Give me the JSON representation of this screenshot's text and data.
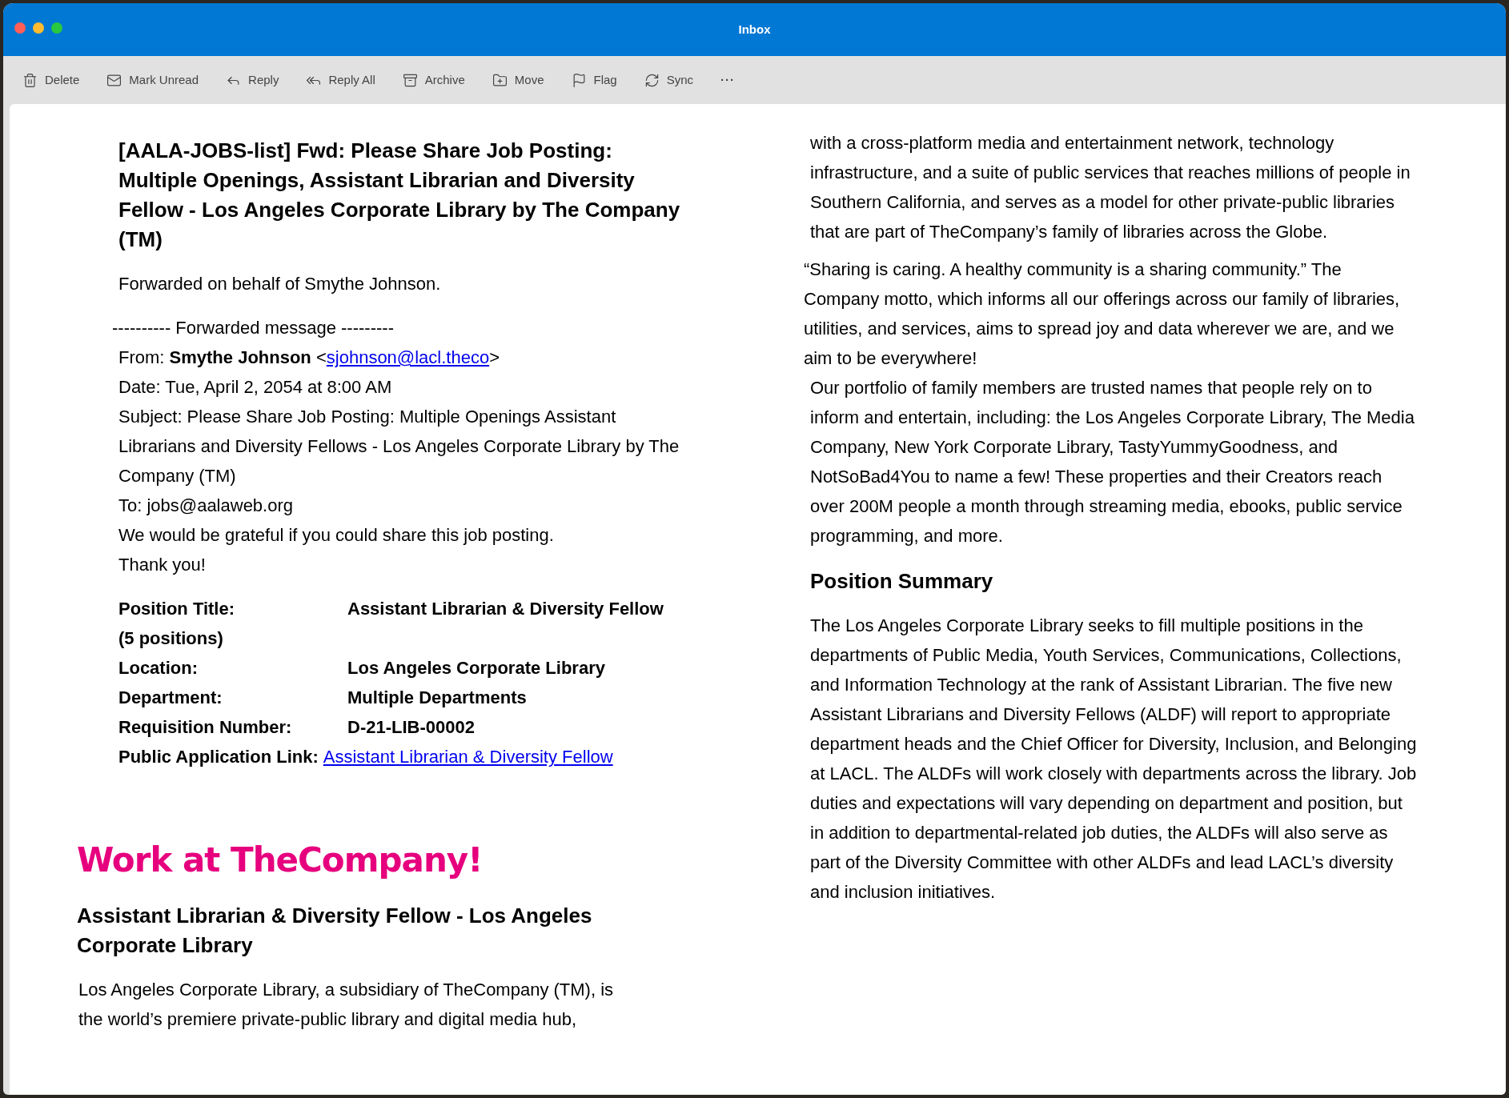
{
  "window": {
    "title": "Inbox"
  },
  "toolbar": [
    {
      "label": "Delete"
    },
    {
      "label": "Mark Unread"
    },
    {
      "label": "Reply"
    },
    {
      "label": "Reply All"
    },
    {
      "label": "Archive"
    },
    {
      "label": "Move"
    },
    {
      "label": "Flag"
    },
    {
      "label": "Sync"
    },
    {
      "label": "···"
    }
  ],
  "email": {
    "subject": "[AALA-JOBS-list]  Fwd: Please Share Job Posting: Multiple Openings, Assistant Librarian and Diversity Fellow - Los Angeles Corporate Library by The Company (TM)",
    "intro": "Forwarded on behalf of Smythe Johnson.",
    "forwarded_divider": "---------- Forwarded message ---------",
    "from": {
      "prefix": "From: **Smythe Johnson** <",
      "email": "sjohnson@lacl.theco",
      "suffix": ">"
    },
    "header_lines": [
      "Date: Tue, April 2, 2054 at 8:00 AM",
      "Subject: Please Share Job Posting: Multiple Openings Assistant Librarians and Diversity Fellows - Los Angeles Corporate Library by The Company (TM)",
      "To: jobs@aalaweb.org",
      "We would be grateful if you could share this job posting.",
      "Thank you!"
    ],
    "details": [
      {
        "label": "Position Title:",
        "value": "Assistant Librarian & Diversity Fellow",
        "note": "(5 positions)"
      },
      {
        "label": "Location:",
        "value": "Los Angeles Corporate Library"
      },
      {
        "label": "Department:",
        "value": "Multiple Departments"
      },
      {
        "label": "Requisition Number:",
        "value": "D-21-LIB-00002"
      },
      {
        "label": "Public Application Link:",
        "link": "Assistant Librarian & Diversity Fellow"
      }
    ],
    "banner": "Work at TheCompany!",
    "job_title": "Assistant Librarian & Diversity Fellow - Los Angeles Corporate Library",
    "about_paragraphs": [
      "Los Angeles Corporate Library, a subsidiary of TheCompany (TM), is the world’s premiere private-public library and digital media hub,",
      "with a cross-platform media and entertainment network, technology infrastructure, and a suite of public services that reaches millions of people in Southern California, and serves as a model for other private-public libraries that are part of TheCompany’s family of libraries across the Globe.",
      "“Sharing is caring. A healthy community is a sharing community.” The Company motto, which informs all our offerings across our family of libraries, utilities, and services, aims to spread joy and data wherever we are, and we aim to be everywhere!",
      "Our portfolio of family members are trusted names that people rely on to inform and entertain, including: the Los Angeles Corporate Library, The Media Company, New York Corporate Library, TastyYummyGoodness, and NotSoBad4You to name a few!  These properties and their Creators reach over 200M people a month through streaming media, ebooks, public service programming, and more."
    ],
    "summary_heading": "Position Summary",
    "summary": "The Los Angeles Corporate Library seeks to fill multiple positions in the departments of Public Media, Youth Services, Communications, Collections, and Information Technology at the rank of Assistant Librarian. The five new Assistant Librarians and Diversity Fellows (ALDF) will report to appropriate department heads and the Chief Officer for Diversity, Inclusion, and Belonging at LACL. The ALDFs will work closely with departments across the library. Job duties and expectations will vary depending on department and position, but in addition to departmental-related job duties, the ALDFs will also serve as part of the Diversity Committee with other ALDFs and lead LACL’s diversity and inclusion initiatives."
  }
}
